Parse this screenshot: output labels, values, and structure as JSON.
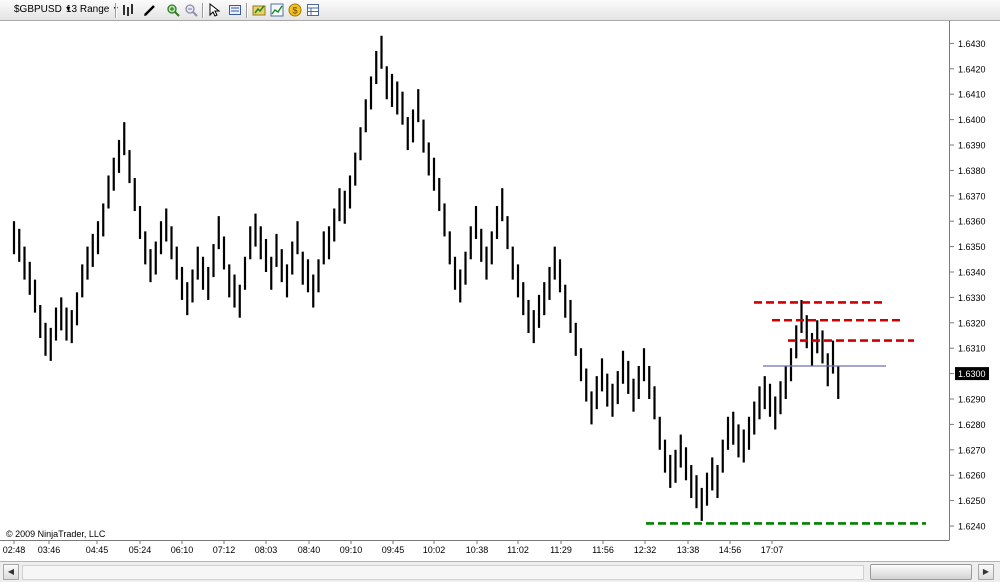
{
  "toolbar": {
    "instrument": "$GBPUSD",
    "period": "13 Range",
    "icons": [
      "bars-style-icon",
      "drawing-tool-icon",
      "zoom-in-icon",
      "zoom-out-icon",
      "pointer-icon",
      "data-box-icon",
      "strategies-icon",
      "indicators-icon",
      "properties-icon",
      "chart-settings-icon"
    ]
  },
  "colors": {
    "bar": "#000000",
    "resistance_line": "#d00000",
    "support_line": "#008000",
    "price_line": "#6f6fb5",
    "price_marker_bg": "#000000",
    "price_marker_text": "#ffffff"
  },
  "copyright": "© 2009 NinjaTrader, LLC",
  "current_price_label": "1.6300",
  "chart_data": {
    "type": "ohlc",
    "title": "",
    "instrument": "$GBPUSD",
    "period": "13 Range",
    "ylim": [
      1.6235,
      1.6438
    ],
    "y_ticks": [
      "1.6240",
      "1.6250",
      "1.6260",
      "1.6270",
      "1.6280",
      "1.6290",
      "1.6300",
      "1.6310",
      "1.6320",
      "1.6330",
      "1.6340",
      "1.6350",
      "1.6360",
      "1.6370",
      "1.6380",
      "1.6390",
      "1.6400",
      "1.6410",
      "1.6420",
      "1.6430"
    ],
    "x_ticks": [
      "02:48",
      "03:46",
      "04:45",
      "05:24",
      "06:10",
      "07:12",
      "08:03",
      "08:40",
      "09:10",
      "09:45",
      "10:02",
      "10:38",
      "11:02",
      "11:29",
      "11:56",
      "12:32",
      "13:38",
      "14:56",
      "17:07"
    ],
    "current_price": 1.63,
    "bars": [
      {
        "high": 1.636,
        "low": 1.6347
      },
      {
        "high": 1.6357,
        "low": 1.6344
      },
      {
        "high": 1.635,
        "low": 1.6337
      },
      {
        "high": 1.6344,
        "low": 1.6331
      },
      {
        "high": 1.6337,
        "low": 1.6324
      },
      {
        "high": 1.6327,
        "low": 1.6314
      },
      {
        "high": 1.632,
        "low": 1.6307
      },
      {
        "high": 1.6318,
        "low": 1.6305
      },
      {
        "high": 1.6326,
        "low": 1.6313
      },
      {
        "high": 1.633,
        "low": 1.6317
      },
      {
        "high": 1.6326,
        "low": 1.6313
      },
      {
        "high": 1.6325,
        "low": 1.6312
      },
      {
        "high": 1.6332,
        "low": 1.6319
      },
      {
        "high": 1.6343,
        "low": 1.633
      },
      {
        "high": 1.635,
        "low": 1.6337
      },
      {
        "high": 1.6355,
        "low": 1.6342
      },
      {
        "high": 1.636,
        "low": 1.6347
      },
      {
        "high": 1.6367,
        "low": 1.6354
      },
      {
        "high": 1.6378,
        "low": 1.6365
      },
      {
        "high": 1.6385,
        "low": 1.6372
      },
      {
        "high": 1.6392,
        "low": 1.6379
      },
      {
        "high": 1.6399,
        "low": 1.6386
      },
      {
        "high": 1.6388,
        "low": 1.6375
      },
      {
        "high": 1.6377,
        "low": 1.6364
      },
      {
        "high": 1.6366,
        "low": 1.6353
      },
      {
        "high": 1.6356,
        "low": 1.6343
      },
      {
        "high": 1.6349,
        "low": 1.6336
      },
      {
        "high": 1.6352,
        "low": 1.6339
      },
      {
        "high": 1.636,
        "low": 1.6347
      },
      {
        "high": 1.6365,
        "low": 1.6352
      },
      {
        "high": 1.6358,
        "low": 1.6345
      },
      {
        "high": 1.635,
        "low": 1.6337
      },
      {
        "high": 1.6342,
        "low": 1.6329
      },
      {
        "high": 1.6336,
        "low": 1.6323
      },
      {
        "high": 1.6341,
        "low": 1.6328
      },
      {
        "high": 1.635,
        "low": 1.6337
      },
      {
        "high": 1.6346,
        "low": 1.6333
      },
      {
        "high": 1.6342,
        "low": 1.6329
      },
      {
        "high": 1.6351,
        "low": 1.6338
      },
      {
        "high": 1.6362,
        "low": 1.6349
      },
      {
        "high": 1.6354,
        "low": 1.6341
      },
      {
        "high": 1.6343,
        "low": 1.633
      },
      {
        "high": 1.6339,
        "low": 1.6326
      },
      {
        "high": 1.6335,
        "low": 1.6322
      },
      {
        "high": 1.6346,
        "low": 1.6333
      },
      {
        "high": 1.6358,
        "low": 1.6345
      },
      {
        "high": 1.6363,
        "low": 1.635
      },
      {
        "high": 1.6358,
        "low": 1.6345
      },
      {
        "high": 1.6353,
        "low": 1.634
      },
      {
        "high": 1.6346,
        "low": 1.6333
      },
      {
        "high": 1.6355,
        "low": 1.6342
      },
      {
        "high": 1.6349,
        "low": 1.6336
      },
      {
        "high": 1.6343,
        "low": 1.633
      },
      {
        "high": 1.6352,
        "low": 1.6339
      },
      {
        "high": 1.636,
        "low": 1.6347
      },
      {
        "high": 1.6348,
        "low": 1.6335
      },
      {
        "high": 1.6345,
        "low": 1.6332
      },
      {
        "high": 1.6339,
        "low": 1.6326
      },
      {
        "high": 1.6345,
        "low": 1.6332
      },
      {
        "high": 1.6356,
        "low": 1.6343
      },
      {
        "high": 1.6358,
        "low": 1.6345
      },
      {
        "high": 1.6365,
        "low": 1.6352
      },
      {
        "high": 1.6373,
        "low": 1.636
      },
      {
        "high": 1.6372,
        "low": 1.6359
      },
      {
        "high": 1.6378,
        "low": 1.6365
      },
      {
        "high": 1.6387,
        "low": 1.6374
      },
      {
        "high": 1.6397,
        "low": 1.6384
      },
      {
        "high": 1.6408,
        "low": 1.6395
      },
      {
        "high": 1.6417,
        "low": 1.6404
      },
      {
        "high": 1.6427,
        "low": 1.6414
      },
      {
        "high": 1.6433,
        "low": 1.642
      },
      {
        "high": 1.6421,
        "low": 1.6408
      },
      {
        "high": 1.6418,
        "low": 1.6405
      },
      {
        "high": 1.6415,
        "low": 1.6402
      },
      {
        "high": 1.6411,
        "low": 1.6398
      },
      {
        "high": 1.6401,
        "low": 1.6388
      },
      {
        "high": 1.6404,
        "low": 1.6391
      },
      {
        "high": 1.6412,
        "low": 1.6399
      },
      {
        "high": 1.64,
        "low": 1.6387
      },
      {
        "high": 1.6391,
        "low": 1.6378
      },
      {
        "high": 1.6385,
        "low": 1.6372
      },
      {
        "high": 1.6377,
        "low": 1.6364
      },
      {
        "high": 1.6367,
        "low": 1.6354
      },
      {
        "high": 1.6356,
        "low": 1.6343
      },
      {
        "high": 1.6346,
        "low": 1.6333
      },
      {
        "high": 1.6341,
        "low": 1.6328
      },
      {
        "high": 1.6348,
        "low": 1.6335
      },
      {
        "high": 1.6358,
        "low": 1.6345
      },
      {
        "high": 1.6366,
        "low": 1.6353
      },
      {
        "high": 1.6357,
        "low": 1.6344
      },
      {
        "high": 1.635,
        "low": 1.6337
      },
      {
        "high": 1.6356,
        "low": 1.6343
      },
      {
        "high": 1.6366,
        "low": 1.6353
      },
      {
        "high": 1.6373,
        "low": 1.636
      },
      {
        "high": 1.6362,
        "low": 1.6349
      },
      {
        "high": 1.635,
        "low": 1.6337
      },
      {
        "high": 1.6343,
        "low": 1.633
      },
      {
        "high": 1.6336,
        "low": 1.6323
      },
      {
        "high": 1.6329,
        "low": 1.6316
      },
      {
        "high": 1.6325,
        "low": 1.6312
      },
      {
        "high": 1.6331,
        "low": 1.6318
      },
      {
        "high": 1.6336,
        "low": 1.6323
      },
      {
        "high": 1.6342,
        "low": 1.6329
      },
      {
        "high": 1.635,
        "low": 1.6337
      },
      {
        "high": 1.6345,
        "low": 1.6332
      },
      {
        "high": 1.6335,
        "low": 1.6322
      },
      {
        "high": 1.6329,
        "low": 1.6316
      },
      {
        "high": 1.632,
        "low": 1.6307
      },
      {
        "high": 1.631,
        "low": 1.6297
      },
      {
        "high": 1.6302,
        "low": 1.6289
      },
      {
        "high": 1.6293,
        "low": 1.628
      },
      {
        "high": 1.6299,
        "low": 1.6286
      },
      {
        "high": 1.6306,
        "low": 1.6293
      },
      {
        "high": 1.63,
        "low": 1.6287
      },
      {
        "high": 1.6296,
        "low": 1.6283
      },
      {
        "high": 1.6301,
        "low": 1.6288
      },
      {
        "high": 1.6309,
        "low": 1.6296
      },
      {
        "high": 1.6305,
        "low": 1.6292
      },
      {
        "high": 1.6298,
        "low": 1.6285
      },
      {
        "high": 1.6303,
        "low": 1.629
      },
      {
        "high": 1.631,
        "low": 1.6297
      },
      {
        "high": 1.6303,
        "low": 1.629
      },
      {
        "high": 1.6295,
        "low": 1.6282
      },
      {
        "high": 1.6283,
        "low": 1.627
      },
      {
        "high": 1.6274,
        "low": 1.6261
      },
      {
        "high": 1.6268,
        "low": 1.6255
      },
      {
        "high": 1.627,
        "low": 1.6257
      },
      {
        "high": 1.6276,
        "low": 1.6263
      },
      {
        "high": 1.6271,
        "low": 1.6258
      },
      {
        "high": 1.6264,
        "low": 1.6251
      },
      {
        "high": 1.626,
        "low": 1.6247
      },
      {
        "high": 1.6255,
        "low": 1.6242
      },
      {
        "high": 1.6261,
        "low": 1.6248
      },
      {
        "high": 1.6267,
        "low": 1.6254
      },
      {
        "high": 1.6264,
        "low": 1.6251
      },
      {
        "high": 1.6274,
        "low": 1.6261
      },
      {
        "high": 1.6283,
        "low": 1.627
      },
      {
        "high": 1.6285,
        "low": 1.6272
      },
      {
        "high": 1.628,
        "low": 1.6267
      },
      {
        "high": 1.6278,
        "low": 1.6265
      },
      {
        "high": 1.6283,
        "low": 1.627
      },
      {
        "high": 1.6289,
        "low": 1.6276
      },
      {
        "high": 1.6295,
        "low": 1.6282
      },
      {
        "high": 1.6299,
        "low": 1.6286
      },
      {
        "high": 1.6296,
        "low": 1.6283
      },
      {
        "high": 1.6291,
        "low": 1.6278
      },
      {
        "high": 1.6297,
        "low": 1.6284
      },
      {
        "high": 1.6303,
        "low": 1.629
      },
      {
        "high": 1.631,
        "low": 1.6297
      },
      {
        "high": 1.6319,
        "low": 1.6306
      },
      {
        "high": 1.6329,
        "low": 1.6316
      },
      {
        "high": 1.6323,
        "low": 1.631
      },
      {
        "high": 1.6316,
        "low": 1.6303
      },
      {
        "high": 1.6321,
        "low": 1.6308
      },
      {
        "high": 1.6317,
        "low": 1.6304
      },
      {
        "high": 1.6308,
        "low": 1.6295
      },
      {
        "high": 1.6313,
        "low": 1.63
      },
      {
        "high": 1.6303,
        "low": 1.629
      }
    ],
    "horizontal_lines": [
      {
        "name": "resistance-line-1",
        "price": 1.6328,
        "style": "dashed",
        "color": "#d00000"
      },
      {
        "name": "resistance-line-2",
        "price": 1.6321,
        "style": "dashed",
        "color": "#d00000"
      },
      {
        "name": "resistance-line-3",
        "price": 1.6313,
        "style": "dashed",
        "color": "#d00000"
      },
      {
        "name": "support-line",
        "price": 1.6241,
        "style": "dashed",
        "color": "#008000"
      },
      {
        "name": "current-price-line",
        "price": 1.6303,
        "style": "solid",
        "color": "#6f6fb5"
      }
    ]
  }
}
